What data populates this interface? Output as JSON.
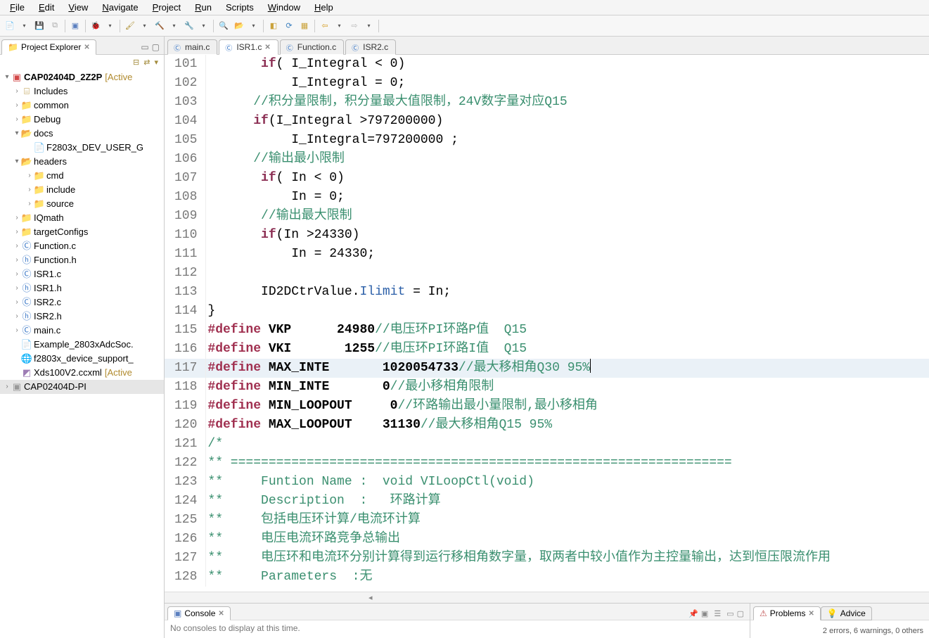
{
  "menubar": {
    "file": "File",
    "edit": "Edit",
    "view": "View",
    "navigate": "Navigate",
    "project": "Project",
    "run": "Run",
    "scripts": "Scripts",
    "window": "Window",
    "help": "Help"
  },
  "project_explorer": {
    "title": "Project Explorer",
    "active_suffix": "[Active",
    "project1": "CAP02404D_2Z2P",
    "project2": "CAP02404D-PI",
    "tree": {
      "includes": "Includes",
      "common": "common",
      "debug": "Debug",
      "docs": "docs",
      "docs_file": "F2803x_DEV_USER_G",
      "headers": "headers",
      "cmd": "cmd",
      "include": "include",
      "source": "source",
      "iqmath": "IQmath",
      "targetConfigs": "targetConfigs",
      "functionc": "Function.c",
      "functionh": "Function.h",
      "isr1c": "ISR1.c",
      "isr1h": "ISR1.h",
      "isr2c": "ISR2.c",
      "isr2h": "ISR2.h",
      "mainc": "main.c",
      "example": "Example_2803xAdcSoc.",
      "f2803x": "f2803x_device_support_",
      "xds": "Xds100V2.ccxml",
      "xds_suf": "[Active"
    }
  },
  "editor_tabs": {
    "t1": "main.c",
    "t2": "ISR1.c",
    "t3": "Function.c",
    "t4": "ISR2.c"
  },
  "code": {
    "ln101": "101",
    "c101a": "if",
    "c101b": "( I_Integral < 0)",
    "ln102": "102",
    "c102": "I_Integral = 0;",
    "ln103": "103",
    "c103": "//积分量限制，积分量最大值限制，24V数字量对应Q15",
    "ln104": "104",
    "c104a": "if",
    "c104b": "(I_Integral >797200000)",
    "ln105": "105",
    "c105": "I_Integral=797200000 ;",
    "ln106": "106",
    "c106": "//输出最小限制",
    "ln107": "107",
    "c107a": "if",
    "c107b": "( In < 0)",
    "ln108": "108",
    "c108": "In = 0;",
    "ln109": "109",
    "c109": "//输出最大限制",
    "ln110": "110",
    "c110a": "if",
    "c110b": "(In >24330)",
    "ln111": "111",
    "c111": "In = 24330;",
    "ln112": "112",
    "ln113": "113",
    "c113a": "ID2DCtrValue.",
    "c113b": "Ilimit",
    "c113c": " = In;",
    "ln114": "114",
    "c114": "}",
    "ln115": "115",
    "c115a": "#define",
    "c115b": " VKP      24980",
    "c115c": "//电压环PI环路P值  Q15",
    "ln116": "116",
    "c116a": "#define",
    "c116b": " VKI       1255",
    "c116c": "//电压环PI环路I值  Q15",
    "ln117": "117",
    "c117a": "#define",
    "c117b": " MAX_INTE       1020054733",
    "c117c": "//最大移相角Q30 95%",
    "ln118": "118",
    "c118a": "#define",
    "c118b": " MIN_INTE       0",
    "c118c": "//最小移相角限制",
    "ln119": "119",
    "c119a": "#define",
    "c119b": " MIN_LOOPOUT     0",
    "c119c": "//环路输出最小量限制,最小移相角",
    "ln120": "120",
    "c120a": "#define",
    "c120b": " MAX_LOOPOUT    31130",
    "c120c": "//最大移相角Q15 95%",
    "ln121": "121",
    "c121": "/*",
    "ln122": "122",
    "c122": "** ==================================================================",
    "ln123": "123",
    "c123": "**     Funtion Name :  void VILoopCtl(void)",
    "ln124": "124",
    "c124": "**     Description  :   环路计算",
    "ln125": "125",
    "c125": "**     包括电压环计算/电流环计算",
    "ln126": "126",
    "c126": "**     电压电流环路竞争总输出",
    "ln127": "127",
    "c127": "**     电压环和电流环分别计算得到运行移相角数字量，取两者中较小值作为主控量输出，达到恒压限流作用",
    "ln128": "128",
    "c128": "**     Parameters  :无"
  },
  "console": {
    "title": "Console",
    "msg": "No consoles to display at this time."
  },
  "problems": {
    "title": "Problems",
    "advice": "Advice",
    "summary": "2 errors, 6 warnings, 0 others"
  }
}
